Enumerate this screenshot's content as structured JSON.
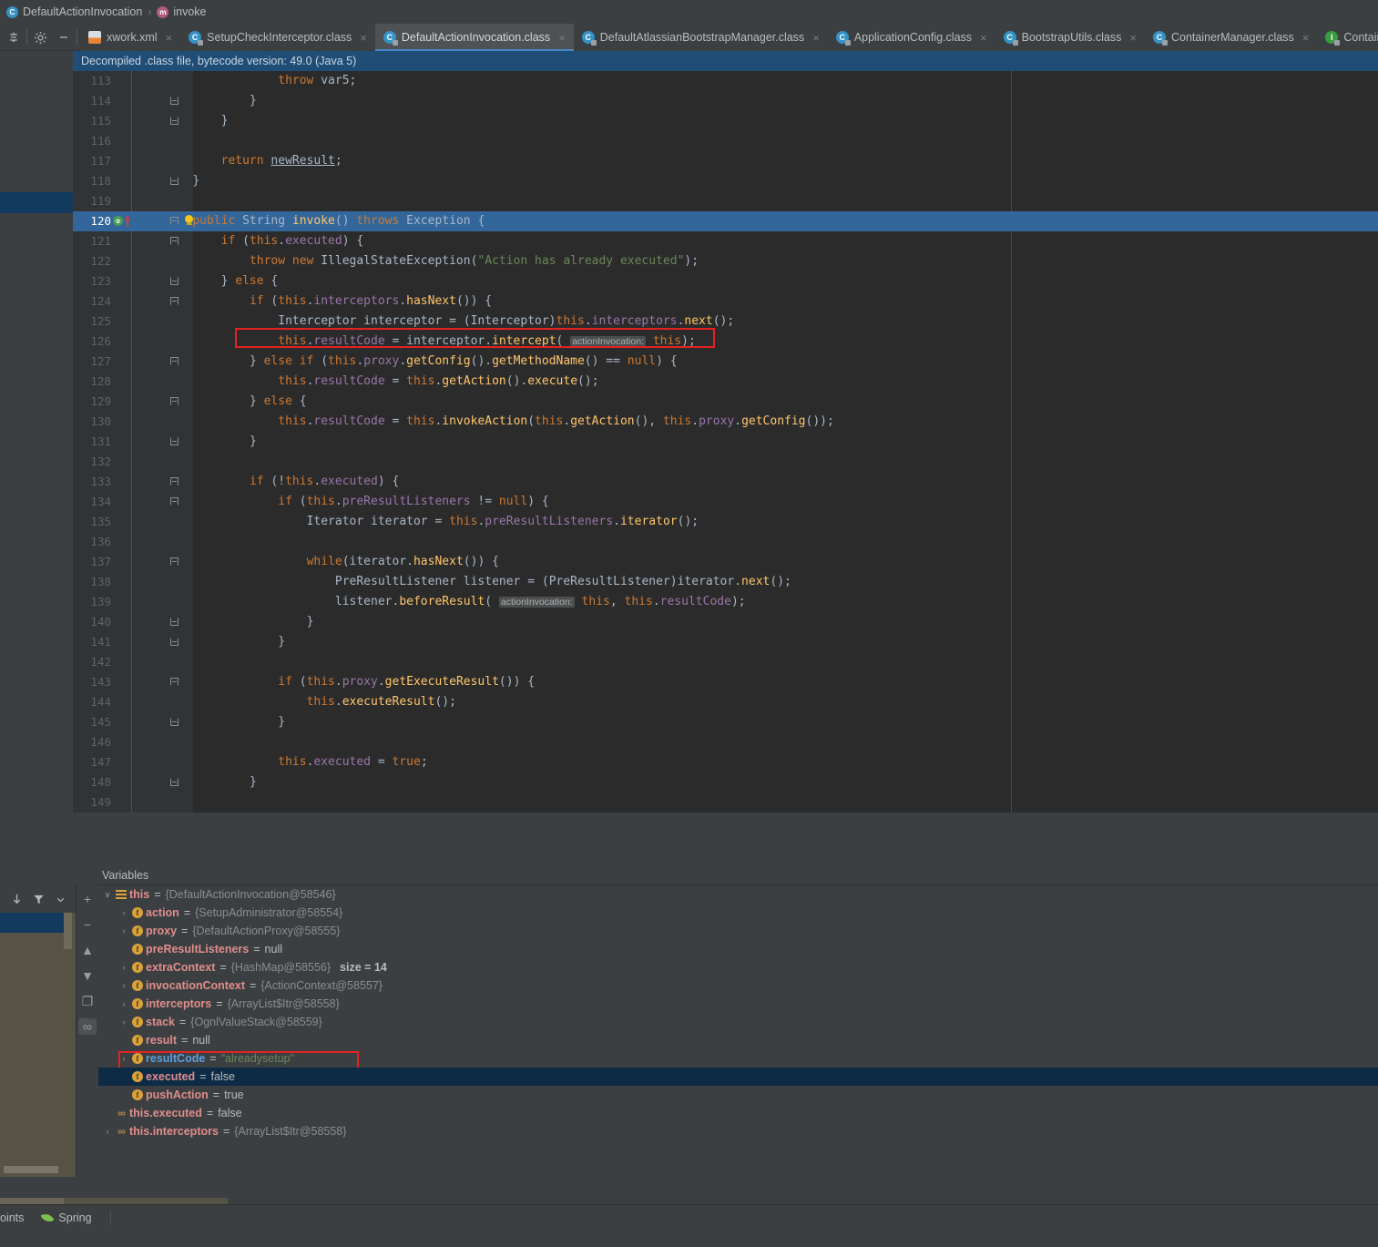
{
  "breadcrumb": {
    "class_icon": "class-icon",
    "class_name": "DefaultActionInvocation",
    "separator": "›",
    "method_icon": "method-icon",
    "method_name": "invoke"
  },
  "toolbar": {
    "collapse_label": "☰",
    "settings_label": "⚙",
    "minimize_label": "−"
  },
  "tabs": [
    {
      "label": "xwork.xml",
      "icon": "xml-file-icon",
      "active": false,
      "close": "×"
    },
    {
      "label": "SetupCheckInterceptor.class",
      "icon": "class-file-icon",
      "active": false,
      "close": "×"
    },
    {
      "label": "DefaultActionInvocation.class",
      "icon": "class-file-icon",
      "active": true,
      "close": "×"
    },
    {
      "label": "DefaultAtlassianBootstrapManager.class",
      "icon": "class-file-icon",
      "active": false,
      "close": "×"
    },
    {
      "label": "ApplicationConfig.class",
      "icon": "class-file-icon",
      "active": false,
      "close": "×"
    },
    {
      "label": "BootstrapUtils.class",
      "icon": "class-file-icon",
      "active": false,
      "close": "×"
    },
    {
      "label": "ContainerManager.class",
      "icon": "class-file-icon",
      "active": false,
      "close": "×"
    },
    {
      "label": "Contain",
      "icon": "interface-file-icon",
      "active": false,
      "close": ""
    }
  ],
  "notice": {
    "text": "Decompiled .class file, bytecode version: 49.0 (Java 5)"
  },
  "editor": {
    "current_line": 120,
    "highlight_color": "#33669a",
    "annotation_color": "#e52222",
    "lines": [
      {
        "n": 113,
        "indent": 0
      },
      {
        "n": 114,
        "indent": 0
      },
      {
        "n": 115,
        "indent": 0
      },
      {
        "n": 116,
        "indent": 0
      },
      {
        "n": 117,
        "indent": 0
      },
      {
        "n": 118,
        "indent": 0
      },
      {
        "n": 119,
        "indent": 0
      },
      {
        "n": 120,
        "indent": 0
      },
      {
        "n": 121,
        "indent": 0
      },
      {
        "n": 122,
        "indent": 0
      },
      {
        "n": 123,
        "indent": 0
      },
      {
        "n": 124,
        "indent": 0
      },
      {
        "n": 125,
        "indent": 0
      },
      {
        "n": 126,
        "indent": 0
      },
      {
        "n": 127,
        "indent": 0
      },
      {
        "n": 128,
        "indent": 0
      },
      {
        "n": 129,
        "indent": 0
      },
      {
        "n": 130,
        "indent": 0
      },
      {
        "n": 131,
        "indent": 0
      },
      {
        "n": 132,
        "indent": 0
      },
      {
        "n": 133,
        "indent": 0
      },
      {
        "n": 134,
        "indent": 0
      },
      {
        "n": 135,
        "indent": 0
      },
      {
        "n": 136,
        "indent": 0
      },
      {
        "n": 137,
        "indent": 0
      },
      {
        "n": 138,
        "indent": 0
      },
      {
        "n": 139,
        "indent": 0
      },
      {
        "n": 140,
        "indent": 0
      },
      {
        "n": 141,
        "indent": 0
      },
      {
        "n": 142,
        "indent": 0
      },
      {
        "n": 143,
        "indent": 0
      },
      {
        "n": 144,
        "indent": 0
      },
      {
        "n": 145,
        "indent": 0
      },
      {
        "n": 146,
        "indent": 0
      },
      {
        "n": 147,
        "indent": 0
      },
      {
        "n": 148,
        "indent": 0
      },
      {
        "n": 149,
        "indent": 0
      }
    ],
    "gutter_icons": {
      "line_120_override": "o",
      "line_120_bulb": "lightbulb-icon"
    },
    "parameter_hints": [
      "actionInvocation:"
    ],
    "code_text": {
      "113": "                throw var5;",
      "114": "            }",
      "115": "        }",
      "116": "",
      "117": "        return newResult;",
      "118": "    }",
      "119": "",
      "120": "    public String invoke() throws Exception {",
      "121": "        if (this.executed) {",
      "122": "            throw new IllegalStateException(\"Action has already executed\");",
      "123": "        } else {",
      "124": "            if (this.interceptors.hasNext()) {",
      "125": "                Interceptor interceptor = (Interceptor)this.interceptors.next();",
      "126": "                this.resultCode = interceptor.intercept( actionInvocation: this);",
      "127": "            } else if (this.proxy.getConfig().getMethodName() == null) {",
      "128": "                this.resultCode = this.getAction().execute();",
      "129": "            } else {",
      "130": "                this.resultCode = this.invokeAction(this.getAction(), this.proxy.getConfig());",
      "131": "            }",
      "132": "",
      "133": "            if (!this.executed) {",
      "134": "                if (this.preResultListeners != null) {",
      "135": "                    Iterator iterator = this.preResultListeners.iterator();",
      "136": "",
      "137": "                    while(iterator.hasNext()) {",
      "138": "                        PreResultListener listener = (PreResultListener)iterator.next();",
      "139": "                        listener.beforeResult( actionInvocation: this, this.resultCode);",
      "140": "                    }",
      "141": "                }",
      "142": "",
      "143": "                if (this.proxy.getExecuteResult()) {",
      "144": "                    this.executeResult();",
      "145": "                }",
      "146": "",
      "147": "                this.executed = true;",
      "148": "            }",
      "149": ""
    }
  },
  "debugger": {
    "header_title": "Variables",
    "toolbar_icons": [
      "step-down-icon",
      "filter-icon",
      "chevron-down-icon"
    ],
    "side_toolbar": [
      {
        "name": "add-watch-button",
        "glyph": "+"
      },
      {
        "name": "remove-watch-button",
        "glyph": "−"
      },
      {
        "name": "move-up-button",
        "glyph": "▲"
      },
      {
        "name": "move-down-button",
        "glyph": "▼"
      },
      {
        "name": "copy-value-button",
        "glyph": "❐"
      },
      {
        "name": "watches-toggle-button",
        "glyph": "∞"
      }
    ],
    "variables": [
      {
        "indent": 0,
        "chev": "∨",
        "icon": "object-icon",
        "name": "this",
        "eq": "=",
        "value": "{DefaultActionInvocation@58546}",
        "value_kind": "object",
        "selected": false,
        "boxed": false
      },
      {
        "indent": 1,
        "chev": "›",
        "icon": "field-icon",
        "name": "action",
        "eq": "=",
        "value": "{SetupAdministrator@58554}",
        "value_kind": "object",
        "selected": false,
        "boxed": false
      },
      {
        "indent": 1,
        "chev": "›",
        "icon": "field-icon",
        "name": "proxy",
        "eq": "=",
        "value": "{DefaultActionProxy@58555}",
        "value_kind": "object",
        "selected": false,
        "boxed": false
      },
      {
        "indent": 1,
        "chev": "",
        "icon": "field-icon",
        "name": "preResultListeners",
        "eq": "=",
        "value": "null",
        "value_kind": "literal",
        "selected": false,
        "boxed": false
      },
      {
        "indent": 1,
        "chev": "›",
        "icon": "field-icon",
        "name": "extraContext",
        "eq": "=",
        "value": "{HashMap@58556}",
        "value_kind": "object",
        "extra": "size = 14",
        "selected": false,
        "boxed": false
      },
      {
        "indent": 1,
        "chev": "›",
        "icon": "field-icon",
        "name": "invocationContext",
        "eq": "=",
        "value": "{ActionContext@58557}",
        "value_kind": "object",
        "selected": false,
        "boxed": false
      },
      {
        "indent": 1,
        "chev": "›",
        "icon": "field-icon",
        "name": "interceptors",
        "eq": "=",
        "value": "{ArrayList$Itr@58558}",
        "value_kind": "object",
        "selected": false,
        "boxed": false
      },
      {
        "indent": 1,
        "chev": "›",
        "icon": "field-icon",
        "name": "stack",
        "eq": "=",
        "value": "{OgnlValueStack@58559}",
        "value_kind": "object",
        "selected": false,
        "boxed": false
      },
      {
        "indent": 1,
        "chev": "",
        "icon": "field-icon",
        "name": "result",
        "eq": "=",
        "value": "null",
        "value_kind": "literal",
        "selected": false,
        "boxed": false
      },
      {
        "indent": 1,
        "chev": "›",
        "icon": "field-icon",
        "name": "resultCode",
        "eq": "=",
        "value": "\"alreadysetup\"",
        "value_kind": "string",
        "selected": false,
        "boxed": true,
        "name_highlight": true
      },
      {
        "indent": 1,
        "chev": "",
        "icon": "field-icon",
        "name": "executed",
        "eq": "=",
        "value": "false",
        "value_kind": "literal",
        "selected": true,
        "boxed": false
      },
      {
        "indent": 1,
        "chev": "",
        "icon": "field-icon",
        "name": "pushAction",
        "eq": "=",
        "value": "true",
        "value_kind": "literal",
        "selected": false,
        "boxed": false
      },
      {
        "indent": 0,
        "chev": "",
        "icon": "watch-icon",
        "name": "this.executed",
        "eq": "=",
        "value": "false",
        "value_kind": "literal",
        "selected": false,
        "boxed": false
      },
      {
        "indent": 0,
        "chev": "›",
        "icon": "watch-icon",
        "name": "this.interceptors",
        "eq": "=",
        "value": "{ArrayList$Itr@58558}",
        "value_kind": "object",
        "selected": false,
        "boxed": false
      }
    ]
  },
  "statusbar": {
    "breakpoints_label": "oints",
    "spring_label": "Spring",
    "spring_icon": "leaf-icon"
  }
}
